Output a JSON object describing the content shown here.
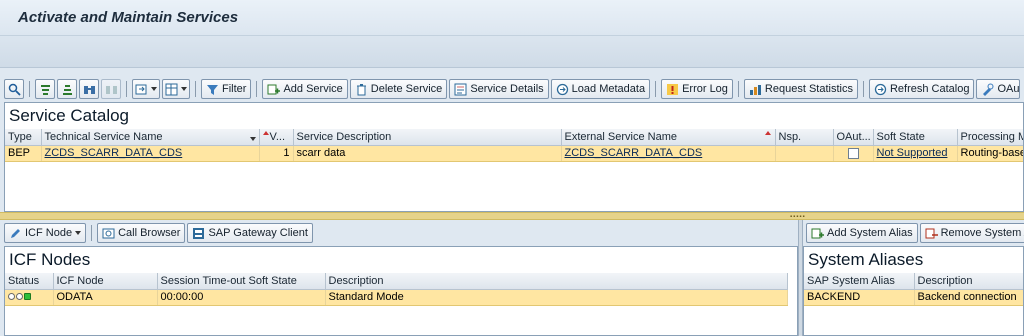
{
  "window": {
    "title": "Activate and Maintain Services"
  },
  "main_toolbar": {
    "filter": "Filter",
    "add_service": "Add Service",
    "delete_service": "Delete Service",
    "service_details": "Service Details",
    "load_metadata": "Load Metadata",
    "error_log": "Error Log",
    "request_statistics": "Request Statistics",
    "refresh_catalog": "Refresh Catalog",
    "oauth": "OAu"
  },
  "catalog": {
    "title": "Service Catalog",
    "columns": [
      "Type",
      "Technical Service Name",
      "V...",
      "Service Description",
      "External Service Name",
      "Nsp.",
      "OAut...",
      "Soft State",
      "Processing Mo"
    ],
    "rows": [
      {
        "type": "BEP",
        "tech_name": "ZCDS_SCARR_DATA_CDS",
        "version": "1",
        "description": "scarr data",
        "external_name": "ZCDS_SCARR_DATA_CDS",
        "nsp": "",
        "soft_state": "Not Supported",
        "processing": "Routing-based"
      }
    ]
  },
  "icf_toolbar": {
    "icf_node": "ICF Node",
    "call_browser": "Call Browser",
    "gateway_client": "SAP Gateway Client"
  },
  "icf": {
    "title": "ICF Nodes",
    "columns": [
      "Status",
      "ICF Node",
      "Session Time-out Soft State",
      "Description"
    ],
    "rows": [
      {
        "node": "ODATA",
        "timeout": "00:00:00",
        "description": "Standard Mode"
      }
    ]
  },
  "alias_toolbar": {
    "add": "Add System Alias",
    "remove": "Remove System A"
  },
  "aliases": {
    "title": "System Aliases",
    "columns": [
      "SAP System Alias",
      "Description"
    ],
    "rows": [
      {
        "alias": "BACKEND",
        "description": "Backend connection"
      }
    ]
  },
  "colors": {
    "selection": "#ffe6a2",
    "status_green": "#2fbf3a"
  }
}
